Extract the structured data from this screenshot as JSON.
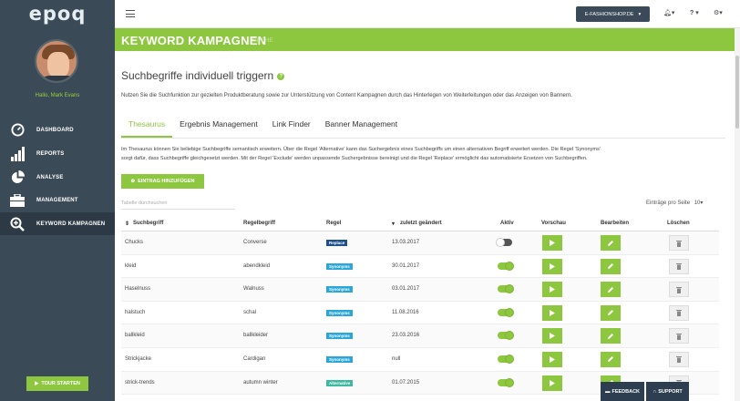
{
  "app": {
    "logo": "epoq"
  },
  "sidebar": {
    "greeting": "Hallo, Mark Evans",
    "items": [
      {
        "label": "DASHBOARD",
        "icon": "dashboard-icon"
      },
      {
        "label": "REPORTS",
        "icon": "bar-chart-icon"
      },
      {
        "label": "ANALYSE",
        "icon": "pie-chart-icon"
      },
      {
        "label": "MANAGEMENT",
        "icon": "briefcase-icon"
      },
      {
        "label": "KEYWORD KAMPAGNEN",
        "icon": "zoom-in-icon"
      }
    ],
    "tour_button": "TOUR STARTEN"
  },
  "topbar": {
    "shop": "E-FASHIONSHOP.DE",
    "bell": "▾",
    "help": "?",
    "settings": "▾"
  },
  "page": {
    "title": "KEYWORD KAMPAGNEN",
    "subtitle": "SUCHE"
  },
  "section": {
    "title": "Suchbegriffe individuell triggern",
    "intro": "Nutzen Sie die Suchfunktion zur gezielten Produktberatung sowie zur Unterstützung von Content Kampagnen durch das Hinterlegen von Weiterleitungen oder das Anzeigen von Bannern."
  },
  "tabs": [
    {
      "label": "Thesaurus",
      "active": true
    },
    {
      "label": "Ergebnis Management"
    },
    {
      "label": "Link Finder"
    },
    {
      "label": "Banner Management"
    }
  ],
  "thesaurus": {
    "description_1": "Im Thesaurus können Sie beliebige Suchbegriffe semantisch erweitern. Über die Regel 'Alternative' kann das Suchergebnis eines Suchbegriffs um einen alternativen Begriff erweitert werden. Die Regel 'Synonyms'",
    "description_2": "sorgt dafür, dass Suchbegriffe gleichgesetzt werden. Mit der Regel 'Exclude' werden unpassende Suchergebnisse bereinigt und die Regel 'Replace' ermöglicht das automatisierte Ersetzen von Suchbegriffen.",
    "add_button": "EINTRAG HINZUFÜGEN",
    "search_placeholder": "Tabelle durchsuchen",
    "per_page_label": "Einträge pro Seite",
    "per_page_value": "10"
  },
  "table": {
    "headers": {
      "term": "Suchbegriff",
      "rule_term": "Regelbegriff",
      "rule": "Regel",
      "changed": "zuletzt geändert",
      "active": "Aktiv",
      "preview": "Vorschau",
      "edit": "Bearbeiten",
      "delete": "Löschen"
    },
    "rows": [
      {
        "term": "Chucks",
        "rule_term": "Converse",
        "rule": "Replace",
        "changed": "13.03.2017",
        "active": false
      },
      {
        "term": "kleid",
        "rule_term": "abendkleid",
        "rule": "Synonyms",
        "changed": "30.01.2017",
        "active": true
      },
      {
        "term": "Haselnuss",
        "rule_term": "Walnuss",
        "rule": "Synonyms",
        "changed": "03.01.2017",
        "active": true
      },
      {
        "term": "halstuch",
        "rule_term": "schal",
        "rule": "Synonyms",
        "changed": "11.08.2016",
        "active": true
      },
      {
        "term": "ballkleid",
        "rule_term": "ballkleider",
        "rule": "Synonyms",
        "changed": "23.03.2016",
        "active": true
      },
      {
        "term": "Strickjacke",
        "rule_term": "Cardigan",
        "rule": "Synonyms",
        "changed": "null",
        "active": true
      },
      {
        "term": "strick-trends",
        "rule_term": "autumn winter",
        "rule": "Alternative",
        "changed": "01.07.2015",
        "active": true
      }
    ]
  },
  "rule_colors": {
    "Replace": "#1d4f8a",
    "Synonyms": "#2aa7d8",
    "Alternative": "#3fb8a0"
  },
  "floating": {
    "feedback": "FEEDBACK",
    "support": "SUPPORT"
  },
  "colors": {
    "accent": "#8dc63f",
    "sidebar": "#3a4a57"
  }
}
